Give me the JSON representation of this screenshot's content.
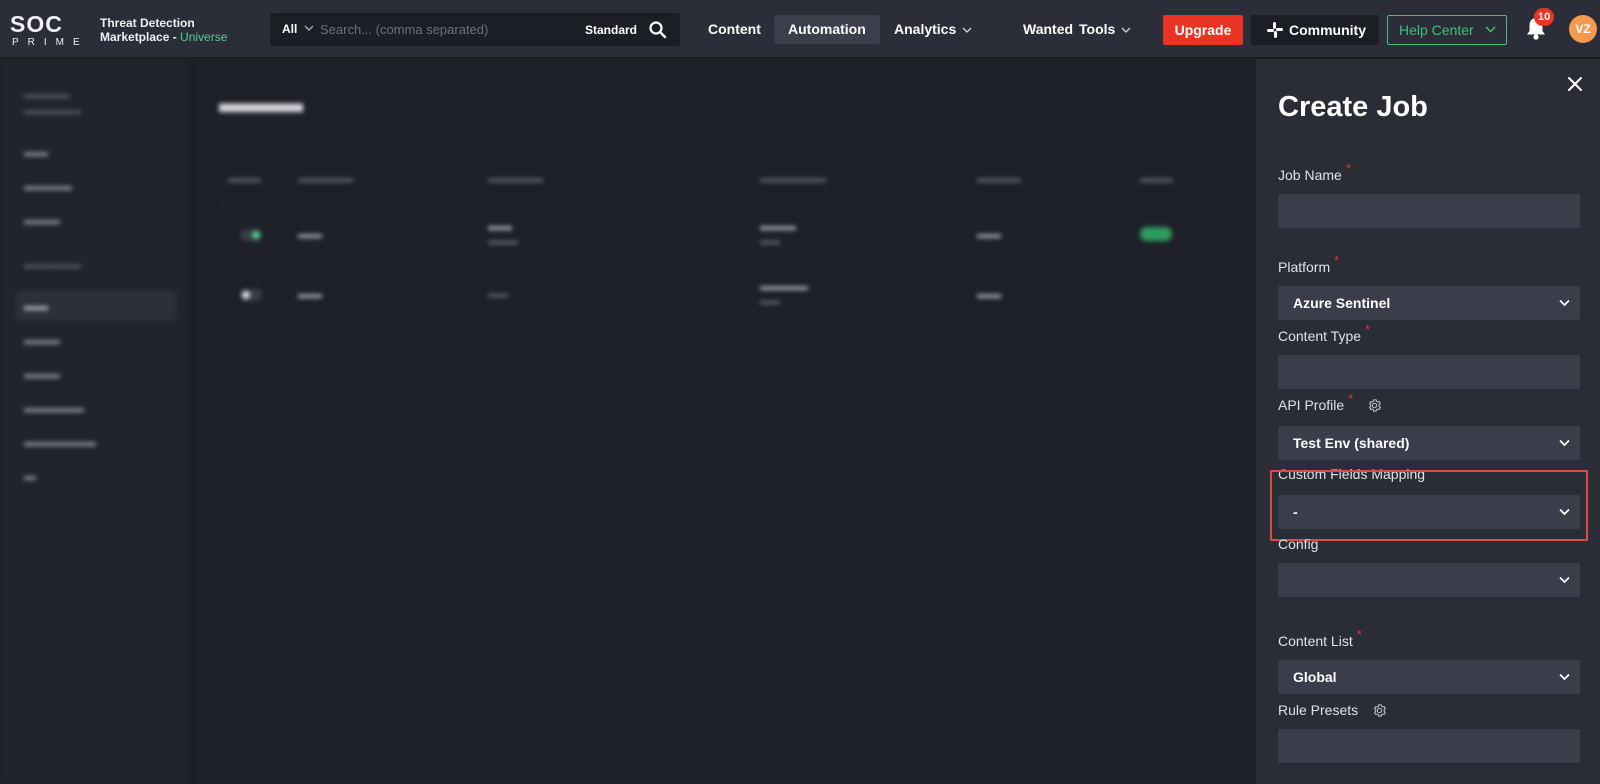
{
  "brand": {
    "line1": "Threat Detection",
    "line2": "Marketplace - ",
    "line2_accent": "Universe",
    "accent_color": "#4fd08b"
  },
  "search": {
    "scope": "All",
    "placeholder": "Search... (comma separated)",
    "mode": "Standard"
  },
  "nav": {
    "content": "Content",
    "automation": "Automation",
    "analytics": "Analytics",
    "wanted": "Wanted",
    "tools": "Tools"
  },
  "actions": {
    "upgrade": "Upgrade",
    "community": "Community",
    "help_center": "Help Center",
    "notifications_count": "10",
    "avatar_initials": "VZ"
  },
  "colors": {
    "danger": "#ea3323",
    "success": "#3ec07b",
    "panel_bg": "#2b2d36",
    "field_bg": "#3a3d4a"
  },
  "panel": {
    "title": "Create Job",
    "fields": {
      "job_name": {
        "label": "Job Name",
        "required": "*",
        "value": ""
      },
      "platform": {
        "label": "Platform",
        "required": "*",
        "value": "Azure Sentinel"
      },
      "content_type": {
        "label": "Content Type",
        "required": "*",
        "value": ""
      },
      "api_profile": {
        "label": "API Profile",
        "required": "*",
        "value": "Test Env (shared)"
      },
      "custom_fields_mapping": {
        "label": "Custom Fields Mapping",
        "value": "-"
      },
      "config": {
        "label": "Config",
        "value": ""
      },
      "content_list": {
        "label": "Content List",
        "required": "*",
        "value": "Global"
      },
      "rule_presets": {
        "label": "Rule Presets",
        "value": ""
      }
    }
  }
}
